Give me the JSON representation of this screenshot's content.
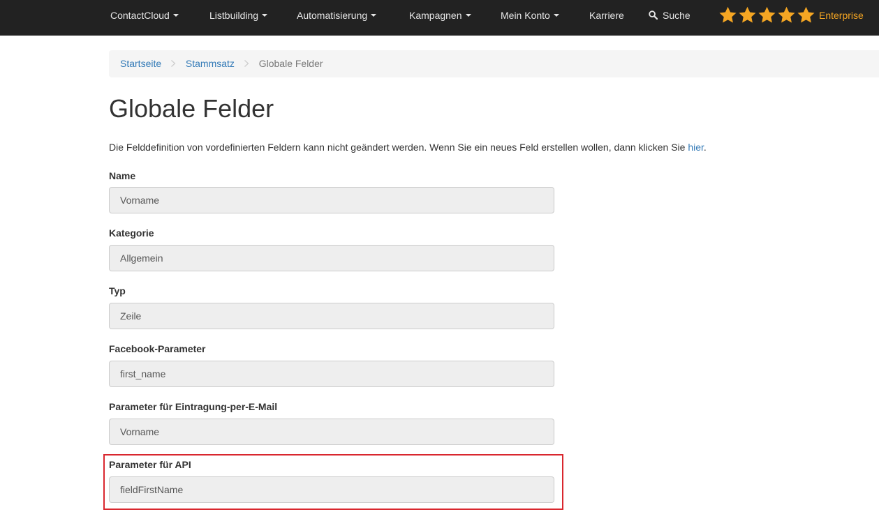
{
  "navbar": {
    "items": [
      {
        "label": "ContactCloud",
        "dropdown": true
      },
      {
        "label": "Listbuilding",
        "dropdown": true
      },
      {
        "label": "Automatisierung",
        "dropdown": true
      },
      {
        "label": "Kampagnen",
        "dropdown": true
      },
      {
        "label": "Mein Konto",
        "dropdown": true
      },
      {
        "label": "Karriere",
        "dropdown": false
      }
    ],
    "search_label": "Suche",
    "search_icon": "search-icon",
    "rating_stars": 5,
    "edition_label": "Enterprise",
    "colors": {
      "background": "#222222",
      "text": "#e6e6e6",
      "stars": "#f5a623"
    }
  },
  "breadcrumb": {
    "items": [
      {
        "label": "Startseite",
        "link": true
      },
      {
        "label": "Stammsatz",
        "link": true
      },
      {
        "label": "Globale Felder",
        "link": false
      }
    ],
    "separator_icon": "chevron-right-icon"
  },
  "page": {
    "title": "Globale Felder",
    "description_text": "Die Felddefinition von vordefinierten Feldern kann nicht geändert werden. Wenn Sie ein neues Feld erstellen wollen, dann klicken Sie ",
    "description_link": "hier",
    "description_end": "."
  },
  "form": {
    "fields": [
      {
        "label": "Name",
        "value": "Vorname"
      },
      {
        "label": "Kategorie",
        "value": "Allgemein"
      },
      {
        "label": "Typ",
        "value": "Zeile"
      },
      {
        "label": "Facebook-Parameter",
        "value": "first_name"
      },
      {
        "label": "Parameter für Eintragung-per-E-Mail",
        "value": "Vorname"
      },
      {
        "label": "Parameter für API",
        "value": "fieldFirstName"
      }
    ],
    "highlighted_field": "Parameter für API",
    "highlight_color": "#d9272e"
  },
  "link_color": "#337ab7"
}
